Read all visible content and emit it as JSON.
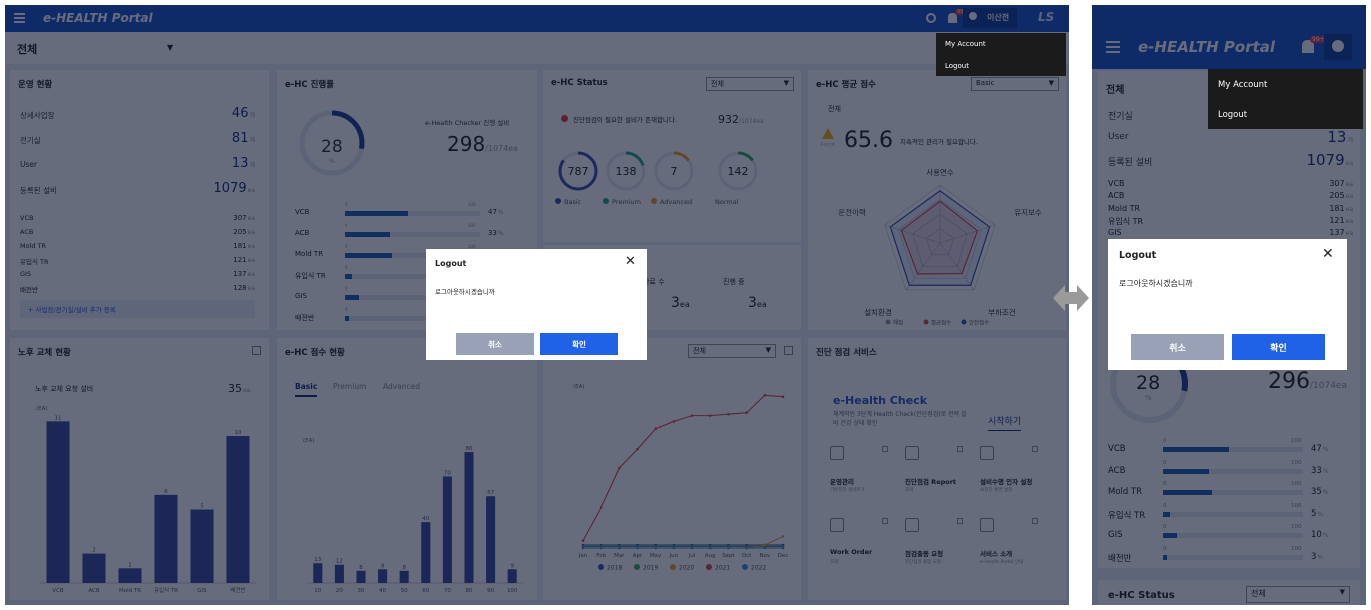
{
  "header": {
    "brand": "e-HEALTH Portal",
    "user": "이산전",
    "badge": "99+",
    "logo": "LS"
  },
  "filter": {
    "selected": "전체"
  },
  "menu": {
    "items": [
      "My Account",
      "Logout"
    ]
  },
  "modal": {
    "title": "Logout",
    "message": "로그아웃하시겠습니까",
    "cancel": "취소",
    "confirm": "확인"
  },
  "ops": {
    "title": "운영 현황",
    "rows": [
      {
        "label": "상세사업장",
        "value": "46",
        "unit": "개"
      },
      {
        "label": "전기실",
        "value": "81",
        "unit": "개"
      },
      {
        "label": "User",
        "value": "13",
        "unit": "개"
      },
      {
        "label": "등록된 설비",
        "value": "1079",
        "unit": "ea"
      }
    ],
    "sub": [
      {
        "label": "VCB",
        "value": "307",
        "unit": "ea"
      },
      {
        "label": "ACB",
        "value": "205",
        "unit": "ea"
      },
      {
        "label": "Mold TR",
        "value": "181",
        "unit": "ea"
      },
      {
        "label": "유입식 TR",
        "value": "121",
        "unit": "ea"
      },
      {
        "label": "GIS",
        "value": "137",
        "unit": "ea"
      },
      {
        "label": "배전반",
        "value": "128",
        "unit": "ea"
      }
    ],
    "add_link": "+ 사업장/전기실/설비 추가 등록"
  },
  "progress": {
    "title": "e-HC 진행률",
    "donut_value": "28",
    "donut_unit": "%",
    "checker_label": "e-Health Checker 진행 설비",
    "checker_value": "298",
    "checker_total": "/1074ea",
    "rows": [
      {
        "label": "VCB",
        "pct": 47,
        "text": "47"
      },
      {
        "label": "ACB",
        "pct": 33,
        "text": "33"
      },
      {
        "label": "Mold TR",
        "pct": 35,
        "text": "35"
      },
      {
        "label": "유입식 TR",
        "pct": 5,
        "text": "5"
      },
      {
        "label": "GIS",
        "pct": 10,
        "text": "10"
      },
      {
        "label": "배전반",
        "pct": 3,
        "text": "3"
      }
    ],
    "scale_min": "0",
    "scale_max": "100",
    "pct_sign": "%"
  },
  "status": {
    "title": "e-HC Status",
    "select": "전체",
    "alert": "진단점검이 필요한 설비가 존재합니다.",
    "alert_value": "932",
    "alert_total": "/1074ea",
    "circles": [
      {
        "value": "787",
        "color": "#3a4fa8"
      },
      {
        "value": "138",
        "color": "#25a38c"
      },
      {
        "value": "7",
        "color": "#f0a020"
      },
      {
        "value": "142",
        "color": "#2fa84f"
      }
    ],
    "legends": [
      "Basic",
      "Premium",
      "Advanced",
      "Normal"
    ],
    "sub_labels": [
      "완료 수",
      "진행 중"
    ],
    "sub_values": [
      "3",
      "3"
    ],
    "sub_unit": "ea"
  },
  "score": {
    "title": "e-HC 평균 점수",
    "select": "Basic",
    "tag": "전체",
    "warn_label": "주의단계",
    "value": "65.6",
    "message": "지속적인 관리가 필요합니다.",
    "axes": [
      "사용연수",
      "유지보수",
      "부하조건",
      "설치환경",
      "운전이력"
    ],
    "legend": [
      "해점",
      "평균점수",
      "안전점수"
    ]
  },
  "aging": {
    "title": "노후 교체 현황",
    "req_label": "노후 교체 요청 설비",
    "req_value": "35",
    "req_unit": "ea",
    "unit": "(EA)",
    "chart_data": {
      "type": "bar",
      "categories": [
        "VCB",
        "ACB",
        "Mold TR",
        "유입식 TR",
        "GIS",
        "배전반"
      ],
      "values": [
        11,
        2,
        1,
        6,
        5,
        10
      ],
      "ylabel": "(EA)"
    }
  },
  "scoredist": {
    "title": "e-HC 점수 현황",
    "tabs": [
      "Basic",
      "Premium",
      "Advanced"
    ],
    "unit": "(EA)",
    "chart_data": {
      "type": "bar",
      "categories": [
        "10",
        "20",
        "30",
        "40",
        "50",
        "60",
        "70",
        "80",
        "90",
        "100"
      ],
      "values": [
        13,
        12,
        8,
        9,
        8,
        40,
        70,
        86,
        57,
        9
      ],
      "ylabel": "(EA)"
    }
  },
  "trend": {
    "select": "전체",
    "unit": "(EA)",
    "chart_data": {
      "type": "line",
      "categories": [
        "Jan",
        "Feb",
        "Mar",
        "Apr",
        "May",
        "Jun",
        "Jul",
        "Aug",
        "Sept",
        "Oct",
        "Nov",
        "Dec"
      ],
      "series": [
        {
          "name": "2018",
          "color": "#3a4fa8",
          "values": [
            2,
            2,
            2,
            2,
            2,
            2,
            2,
            2,
            2,
            2,
            2,
            2
          ]
        },
        {
          "name": "2019",
          "color": "#3fae5c",
          "values": [
            1,
            1,
            1,
            1,
            1,
            1,
            1,
            1,
            1,
            1,
            1,
            1
          ]
        },
        {
          "name": "2020",
          "color": "#f0a020",
          "values": [
            0,
            0,
            0,
            0,
            0,
            0,
            0,
            0,
            0,
            0,
            2,
            8
          ]
        },
        {
          "name": "2021",
          "color": "#d64a4a",
          "values": [
            5,
            28,
            55,
            68,
            82,
            87,
            91,
            91,
            92,
            93,
            105,
            104
          ]
        },
        {
          "name": "2022",
          "color": "#3a8ee6",
          "values": [
            0,
            0,
            0,
            0,
            0,
            0,
            0,
            0,
            0,
            0,
            0,
            0
          ]
        }
      ],
      "ylabel": "(EA)"
    }
  },
  "service": {
    "title": "진단 점검 서비스",
    "brand": "e-Health Check",
    "desc": "체계적인 3단계 Health Check(진단점검)로 전력 설비 건강 상태 확인",
    "start": "시작하기",
    "items": [
      {
        "t": "운영관리",
        "s": "기본진단 설비추가"
      },
      {
        "t": "진단점검 Report",
        "s": "조회"
      },
      {
        "t": "설비수명 인자 설정",
        "s": "AI진단 환경 설정"
      },
      {
        "t": "Work Order",
        "s": "조회"
      },
      {
        "t": "점검출동 요청",
        "s": "진단점검 출동 요청"
      },
      {
        "t": "서비스 소개",
        "s": "e-Health Portal 안내"
      }
    ]
  },
  "mobile": {
    "rows": [
      {
        "label": "전기실",
        "value": "",
        "unit": ""
      },
      {
        "label": "User",
        "value": "13",
        "unit": "개"
      },
      {
        "label": "등록된 설비",
        "value": "1079",
        "unit": "ea"
      }
    ],
    "sub": [
      {
        "label": "VCB",
        "value": "307",
        "unit": "ea"
      },
      {
        "label": "ACB",
        "value": "205",
        "unit": "ea"
      },
      {
        "label": "Mold TR",
        "value": "181",
        "unit": "ea"
      },
      {
        "label": "유입식 TR",
        "value": "121",
        "unit": "ea"
      },
      {
        "label": "GIS",
        "value": "137",
        "unit": "ea"
      }
    ],
    "donut_value": "28",
    "donut_unit": "%",
    "checker_value": "296",
    "checker_total": "/1074ea",
    "status_title": "e-HC Status",
    "status_select": "전체"
  }
}
